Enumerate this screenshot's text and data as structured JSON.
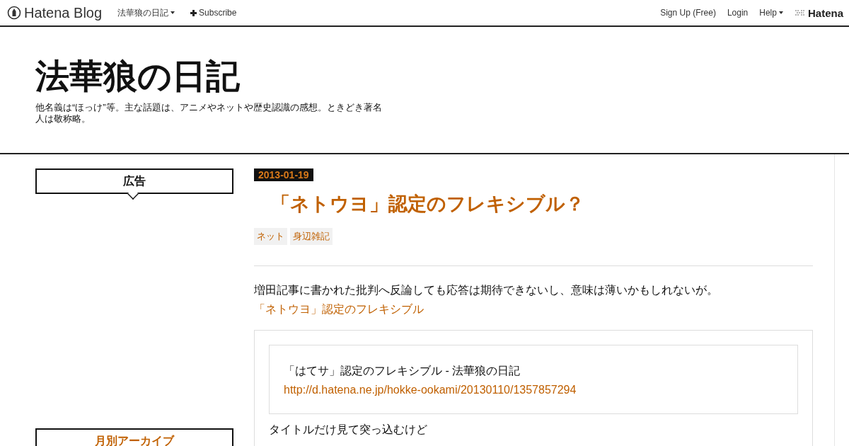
{
  "navbar": {
    "logo": "Hatena Blog",
    "blog_menu": "法華狼の日記",
    "subscribe": "Subscribe",
    "links": [
      "Sign Up (Free)",
      "Login"
    ],
    "help": "Help",
    "brand": "Hatena"
  },
  "header": {
    "title": "法華狼の日記",
    "description": "他名義は“ほっけ”等。主な話題は、アニメやネットや歴史認識の感想。ときどき著名人は敬称略。"
  },
  "sidebar": [
    {
      "title": "広告",
      "linked": false
    },
    {
      "title": "月別アーカイブ",
      "linked": true
    }
  ],
  "entry": {
    "date": "2013-01-19",
    "title": "「ネトウヨ」認定のフレキシブル？",
    "categories": [
      "ネット",
      "身辺雑記"
    ],
    "intro": "増田記事に書かれた批判へ反論しても応答は期待できないし、意味は薄いかもしれないが。",
    "intro_link": "「ネトウヨ」認定のフレキシブル",
    "quote": {
      "title": "「はてサ」認定のフレキシブル - 法華狼の日記",
      "url": "http://d.hatena.ne.jp/hokke-ookami/20130110/1357857294",
      "after": [
        "タイトルだけ見て突っ込むけど"
      ]
    }
  }
}
